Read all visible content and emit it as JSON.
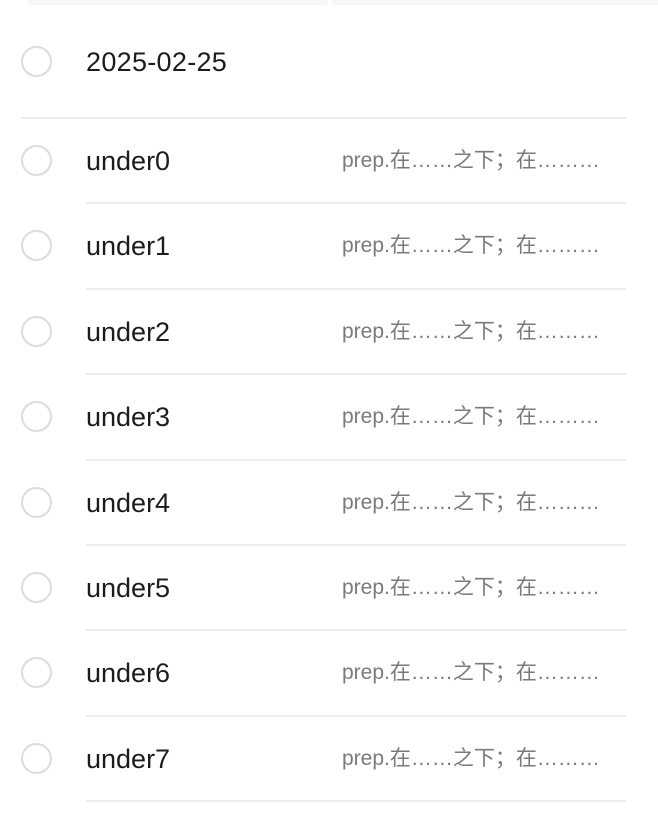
{
  "group": {
    "date": "2025-02-25"
  },
  "words": [
    {
      "word": "under0",
      "meaning": "prep.在……之下；在………"
    },
    {
      "word": "under1",
      "meaning": "prep.在……之下；在………"
    },
    {
      "word": "under2",
      "meaning": "prep.在……之下；在………"
    },
    {
      "word": "under3",
      "meaning": "prep.在……之下；在………"
    },
    {
      "word": "under4",
      "meaning": "prep.在……之下；在………"
    },
    {
      "word": "under5",
      "meaning": "prep.在……之下；在………"
    },
    {
      "word": "under6",
      "meaning": "prep.在……之下；在………"
    },
    {
      "word": "under7",
      "meaning": "prep.在……之下；在………"
    }
  ],
  "colors": {
    "text_primary": "#1c1c1c",
    "text_secondary": "#7a7a7a",
    "divider": "#ececec",
    "radio_border": "#dcdcdc"
  }
}
